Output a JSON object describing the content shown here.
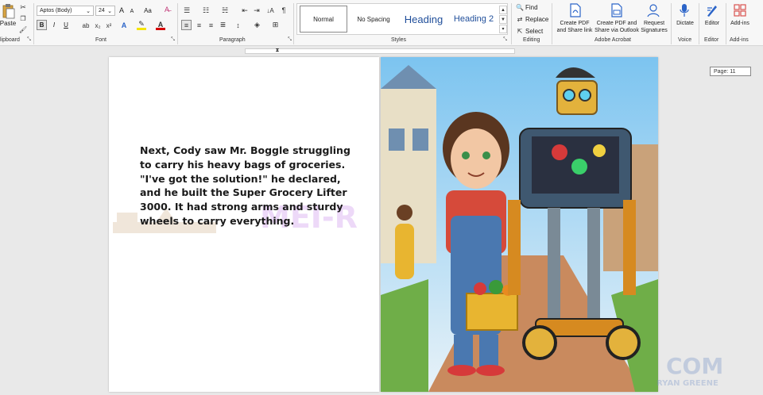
{
  "ribbon": {
    "clipboard": {
      "label": "lipboard",
      "paste_label": "Paste"
    },
    "font": {
      "label": "Font",
      "font_name": "Aptos (Body)",
      "font_size": "24",
      "bold": "B",
      "italic": "I",
      "underline": "U",
      "grow": "A",
      "shrink": "A",
      "case": "Aa"
    },
    "paragraph": {
      "label": "Paragraph"
    },
    "styles": {
      "label": "Styles",
      "items": [
        "Normal",
        "No Spacing",
        "Heading",
        "Heading 2"
      ]
    },
    "editing": {
      "label": "Editing",
      "find": "Find",
      "replace": "Replace",
      "select": "Select"
    },
    "acrobat": {
      "label": "Adobe Acrobat",
      "create_pdf_share": "Create PDF and Share link",
      "create_pdf_outlook": "Create PDF and Share via Outlook",
      "request_signatures": "Request Signatures"
    },
    "voice": {
      "label": "Voice",
      "dictate": "Dictate"
    },
    "editor": {
      "label": "Editor",
      "editor": "Editor"
    },
    "addins": {
      "label": "Add-ins",
      "addins": "Add-ins"
    }
  },
  "document": {
    "story_text": "Next, Cody saw Mr. Boggle struggling to carry his heavy bags of groceries. \"I've got the solution!\" he declared, and he built the Super Grocery Lifter 3000. It had strong arms and sturdy wheels to carry everything.",
    "watermark": "MEI-R",
    "page_indicator": "Page: 11",
    "watermark_corner": "COM",
    "watermark_corner_sub": "RYAN GREENE"
  },
  "colors": {
    "ribbon_bg": "#f7f7f7",
    "canvas_bg": "#e9e9e9",
    "heading_blue": "#1f4e9a",
    "acrobat_blue": "#2b64c8"
  }
}
